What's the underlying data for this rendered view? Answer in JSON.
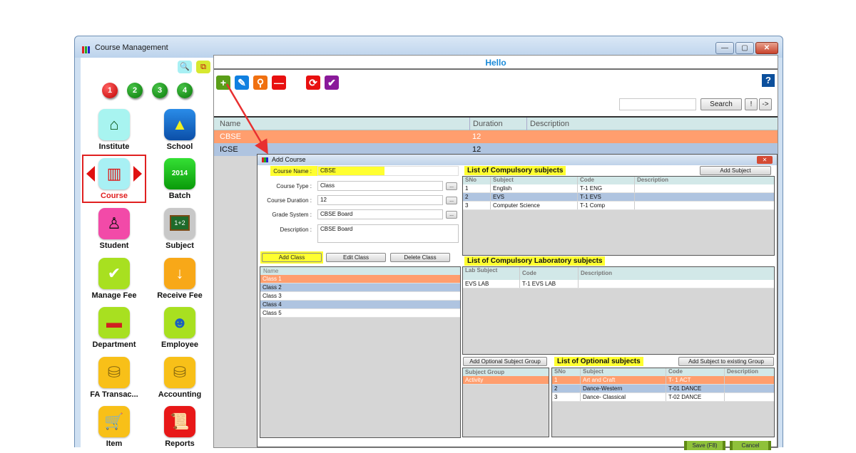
{
  "window": {
    "title": "Course Management",
    "min_label": "—",
    "max_label": "▢",
    "close_label": "✕"
  },
  "sidebar": {
    "search_icon": "🔍",
    "switch_icon": "⧉",
    "numbers": [
      "1",
      "2",
      "3",
      "4"
    ],
    "tiles": [
      {
        "label": "Institute",
        "icon": "house-icon",
        "glyph": "⌂"
      },
      {
        "label": "School",
        "icon": "school-icon",
        "glyph": "▲"
      },
      {
        "label": "Course",
        "icon": "books-icon",
        "glyph": "▥"
      },
      {
        "label": "Batch",
        "icon": "calendar-icon",
        "glyph": "2014"
      },
      {
        "label": "Student",
        "icon": "student-icon",
        "glyph": "♙"
      },
      {
        "label": "Subject",
        "icon": "blackboard-icon",
        "glyph": "1+2"
      },
      {
        "label": "Manage Fee",
        "icon": "manage-fee-icon",
        "glyph": "✔"
      },
      {
        "label": "Receive Fee",
        "icon": "receive-fee-icon",
        "glyph": "↓"
      },
      {
        "label": "Department",
        "icon": "department-icon",
        "glyph": "▬"
      },
      {
        "label": "Employee",
        "icon": "employee-icon",
        "glyph": "☻"
      },
      {
        "label": "FA Transac...",
        "icon": "coins-transfer-icon",
        "glyph": "⛁"
      },
      {
        "label": "Accounting",
        "icon": "coins-icon",
        "glyph": "⛁"
      },
      {
        "label": "Item",
        "icon": "cart-icon",
        "glyph": "🛒"
      },
      {
        "label": "Reports",
        "icon": "report-scroll-icon",
        "glyph": "📜"
      }
    ]
  },
  "main": {
    "header": "Hello",
    "toolbar": {
      "add": "+",
      "edit": "✎",
      "view": "⚲",
      "delete": "—",
      "refresh": "⟳",
      "approve": "✔",
      "help": "?"
    },
    "search": {
      "value": "",
      "button": "Search",
      "excl_button": "!",
      "next_button": "->"
    },
    "grid": {
      "columns": [
        "Name",
        "Duration",
        "Description"
      ],
      "rows": [
        {
          "name": "CBSE",
          "duration": "12",
          "description": ""
        },
        {
          "name": "ICSE",
          "duration": "12",
          "description": ""
        }
      ]
    }
  },
  "dialog": {
    "title": "Add Course",
    "close": "✕",
    "fields": {
      "course_name_label": "Course Name :",
      "course_name": "CBSE",
      "course_type_label": "Course Type :",
      "course_type": "Class",
      "course_duration_label": "Course Duration :",
      "course_duration": "12",
      "grade_system_label": "Grade System :",
      "grade_system": "CBSE Board",
      "description_label": "Description :",
      "description": "CBSE Board",
      "ellipsis": "..."
    },
    "class_buttons": {
      "add": "Add Class",
      "edit": "Edit Class",
      "delete": "Delete Class"
    },
    "classes": {
      "column": "Name",
      "rows": [
        "Class 1",
        "Class 2",
        "Class 3",
        "Class 4",
        "Class 5"
      ]
    },
    "compulsory": {
      "title": "List of Compulsory subjects",
      "add_button": "Add Subject",
      "columns": [
        "SNo",
        "Subject",
        "Code",
        "Description"
      ],
      "rows": [
        {
          "sno": "1",
          "subject": "English",
          "code": "T-1 ENG",
          "description": ""
        },
        {
          "sno": "2",
          "subject": "EVS",
          "code": "T-1 EVS",
          "description": ""
        },
        {
          "sno": "3",
          "subject": "Computer Science",
          "code": "T-1 Comp",
          "description": ""
        }
      ]
    },
    "lab": {
      "title": "List of Compulsory Laboratory subjects",
      "columns": [
        "Lab Subject",
        "Code",
        "Description"
      ],
      "rows": [
        {
          "subject": "EVS LAB",
          "code": "T-1 EVS LAB",
          "description": ""
        }
      ]
    },
    "optional": {
      "add_group_button": "Add Optional Subject Group",
      "title": "List of Optional subjects",
      "add_to_group_button": "Add Subject to existing Group",
      "group_column": "Subject Group",
      "groups": [
        "Activity"
      ],
      "columns": [
        "SNo",
        "Subject",
        "Code",
        "Description"
      ],
      "rows": [
        {
          "sno": "1",
          "subject": "Art and Craft",
          "code": "T- 1 ACT",
          "description": ""
        },
        {
          "sno": "2",
          "subject": "Dance-Western",
          "code": "T-01 DANCE",
          "description": ""
        },
        {
          "sno": "3",
          "subject": "Dance- Classical",
          "code": "T-02 DANCE",
          "description": ""
        }
      ]
    },
    "save_button": "Save (F8)",
    "cancel_button": "Cancel"
  },
  "colors": {
    "selected_row": "#ff9e6e",
    "alt_row": "#afc4e0",
    "highlight": "#ffff30",
    "accent": "#1a8ad8"
  }
}
